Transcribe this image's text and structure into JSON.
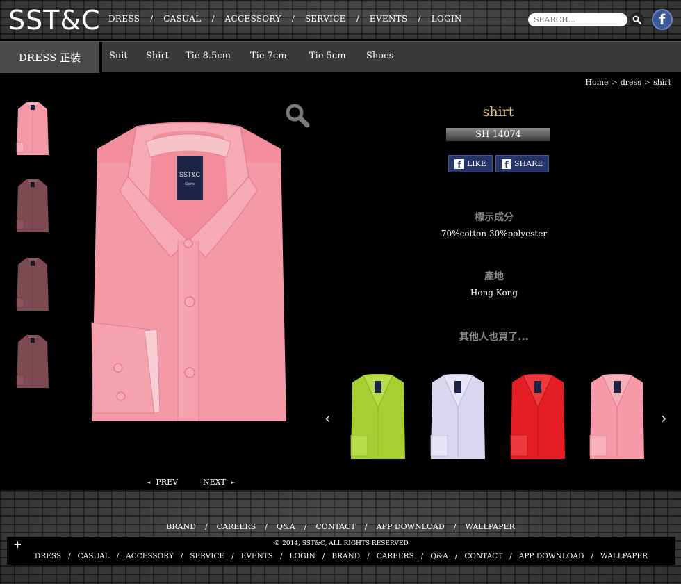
{
  "header": {
    "logo": "SST&C",
    "nav": [
      "DRESS",
      "CASUAL",
      "ACCESSORY",
      "SERVICE",
      "EVENTS",
      "LOGIN"
    ],
    "nav_separator": "/",
    "search_placeholder": "SEARCH...",
    "facebook_icon": "f"
  },
  "subnav": {
    "title": "DRESS 正裝",
    "items": [
      "Suit",
      "Shirt",
      "Tie 8.5cm",
      "Tie 7cm",
      "Tie 5cm",
      "Shoes"
    ]
  },
  "breadcrumb": {
    "items": [
      "Home",
      "dress",
      "shirt"
    ],
    "separator": ">"
  },
  "product": {
    "name": "shirt",
    "code": "SH 14074",
    "like_label": "LIKE",
    "share_label": "SHARE",
    "composition_label": "標示成分",
    "composition_value": "70%cotton 30%polyester",
    "origin_label": "產地",
    "origin_value": "Hong Kong",
    "label_brand": "SST&C",
    "label_sub": "Shirts",
    "shirt_color": "#f49aa6"
  },
  "related": {
    "title": "其他人也買了...",
    "prev_arrow": "‹",
    "next_arrow": "›",
    "colors": [
      "#a6cf32",
      "#d9d6ef",
      "#e51e25",
      "#f59aa6"
    ]
  },
  "pager": {
    "prev": "PREV",
    "next": "NEXT",
    "prev_arrow": "◄",
    "next_arrow": "►"
  },
  "footer": {
    "links": [
      "BRAND",
      "CAREERS",
      "Q&A",
      "CONTACT",
      "APP DOWNLOAD",
      "WALLPAPER"
    ],
    "copyright": "© 2014, SST&C, ALL RIGHTS RESERVED",
    "plus": "+",
    "nav": [
      "DRESS",
      "CASUAL",
      "ACCESSORY",
      "SERVICE",
      "EVENTS",
      "LOGIN",
      "BRAND",
      "CAREERS",
      "Q&A",
      "CONTACT",
      "APP DOWNLOAD",
      "WALLPAPER"
    ],
    "separator": "/"
  },
  "colors": {
    "accent_gold": "#e8c77a",
    "facebook_blue": "#3b5998",
    "label_gray": "#8a8a8a"
  }
}
